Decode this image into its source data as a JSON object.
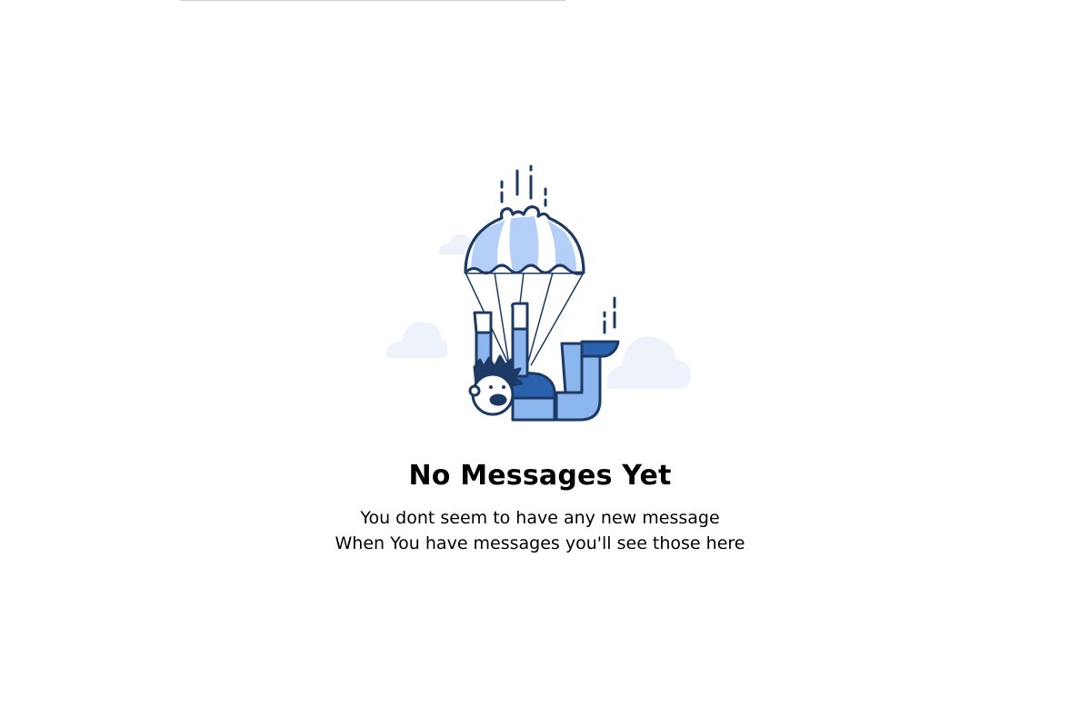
{
  "empty_state": {
    "title": "No Messages Yet",
    "line1": "You dont seem to have any new message",
    "line2": "When You have messages you'll see those here",
    "illustration": "parachute-skydiver-illustration"
  },
  "colors": {
    "outline": "#1c3a63",
    "light_blue": "#b5d0f8",
    "mid_blue": "#8cb6ee",
    "dark_blue": "#2a62ad",
    "cloud": "#edf2fb"
  }
}
